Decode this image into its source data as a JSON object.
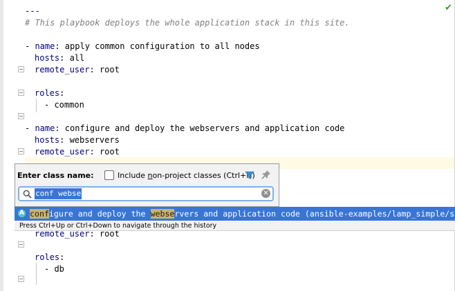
{
  "editor": {
    "lines": {
      "l1": "---",
      "l2": "# This playbook deploys the whole application stack in this site.",
      "l3_dash": "- ",
      "l3_key": "name",
      "l3_val": ": apply common configuration to all nodes",
      "l4_key": "hosts",
      "l4_val": ": all",
      "l5_key": "remote_user",
      "l5_val": ": root",
      "l6_key": "roles",
      "l6_val": ":",
      "l7": "- common",
      "l8_dash": "- ",
      "l8_key": "name",
      "l8_val": ": configure and deploy the webservers and application code",
      "l9_key": "hosts",
      "l9_val": ": webservers",
      "l10_key": "remote_user",
      "l10_val": ": root",
      "l11_key": "remote_user",
      "l11_val": ": root",
      "l12_key": "roles",
      "l12_val": ":",
      "l13": "- db"
    },
    "status_icon": "check-icon"
  },
  "popup": {
    "title": "Enter class name:",
    "checkbox_label_pre": "Include ",
    "checkbox_label_mnemonic": "n",
    "checkbox_label_post": "on-project classes (Ctrl+N)",
    "checkbox_checked": false,
    "search_value": "conf webse",
    "icons": [
      "filter-icon",
      "pin-icon",
      "search-icon",
      "clear-icon"
    ]
  },
  "results": {
    "item_icon_letter": "A",
    "item_hl1": "conf",
    "item_mid1": "igure and deploy the ",
    "item_hl2": "webse",
    "item_rest": "rvers and application code (ansible-examples/lamp_simple/s",
    "hint": "Press Ctrl+Up or Ctrl+Down to navigate through the history"
  },
  "colors": {
    "selection": "#3875d7",
    "match_highlight": "#c9b56a",
    "yaml_key": "#000080",
    "comment": "#808080",
    "current_line": "#fffae3"
  }
}
